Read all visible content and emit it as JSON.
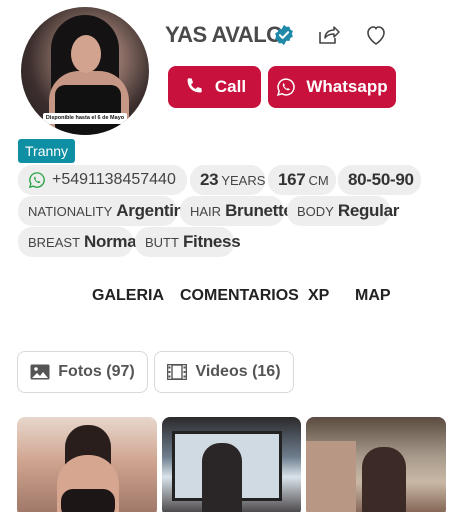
{
  "profile": {
    "name": "YAS AVALO",
    "avatar_caption": "Disponible hasta el 6 de Mayo",
    "tag": "Tranny"
  },
  "actions": {
    "call_label": "Call",
    "whatsapp_label": "Whatsapp"
  },
  "details": {
    "phone": "+5491138457440",
    "age_value": "23",
    "age_unit": "YEARS",
    "height_value": "167",
    "height_unit": "CM",
    "measurements": "80-50-90",
    "nationality_label": "NATIONALITY",
    "nationality_value": "Argentina",
    "hair_label": "HAIR",
    "hair_value": "Brunette",
    "body_label": "BODY",
    "body_value": "Regular",
    "breast_label": "BREAST",
    "breast_value": "Normal",
    "butt_label": "BUTT",
    "butt_value": "Fitness"
  },
  "nav": {
    "items": [
      "GALERIA",
      "COMENTARIOS",
      "XP",
      "MAP"
    ]
  },
  "media_tabs": {
    "photos_label": "Fotos (97)",
    "videos_label": "Videos (16)"
  },
  "icons": {
    "verified": "verified-badge-icon",
    "share": "share-icon",
    "favorite": "heart-icon",
    "phone": "phone-icon",
    "whatsapp": "whatsapp-icon",
    "photos": "image-icon",
    "videos": "film-icon"
  },
  "colors": {
    "accent": "#c8113c",
    "tag": "#0f8fa3",
    "verified": "#1f8aa8",
    "whatsapp": "#25a244",
    "pill_bg": "#eeeeee"
  }
}
